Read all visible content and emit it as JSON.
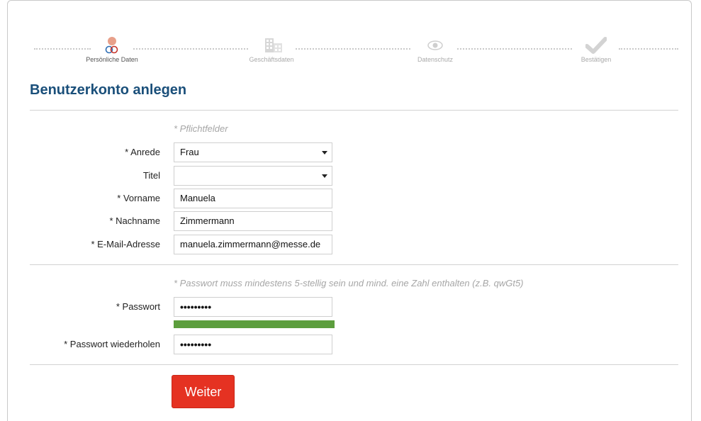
{
  "steps": [
    {
      "label": "Persönliche Daten",
      "icon": "person-icon",
      "active": true
    },
    {
      "label": "Geschäftsdaten",
      "icon": "building-icon",
      "active": false
    },
    {
      "label": "Datenschutz",
      "icon": "eye-icon",
      "active": false
    },
    {
      "label": "Bestätigen",
      "icon": "checkmark-icon",
      "active": false
    }
  ],
  "title": "Benutzerkonto anlegen",
  "required_hint": "* Pflichtfelder",
  "fields": {
    "anrede": {
      "label": "* Anrede",
      "value": "Frau"
    },
    "titel": {
      "label": "Titel",
      "value": ""
    },
    "vorname": {
      "label": "* Vorname",
      "value": "Manuela"
    },
    "nachname": {
      "label": "* Nachname",
      "value": "Zimmermann"
    },
    "email": {
      "label": "* E-Mail-Adresse",
      "value": "manuela.zimmermann@messe.de"
    }
  },
  "password_hint": "* Passwort muss mindestens 5-stellig sein und mind. eine Zahl enthalten (z.B. qwGt5)",
  "password": {
    "label": "* Passwort",
    "value": "•••••••••",
    "strength": 1.0
  },
  "password_repeat": {
    "label": "* Passwort wiederholen",
    "value": "•••••••••"
  },
  "submit_label": "Weiter",
  "colors": {
    "accent": "#1a4f7a",
    "button": "#e53222",
    "strength": "#5c9e3d",
    "step_active": "#e8a08a"
  }
}
